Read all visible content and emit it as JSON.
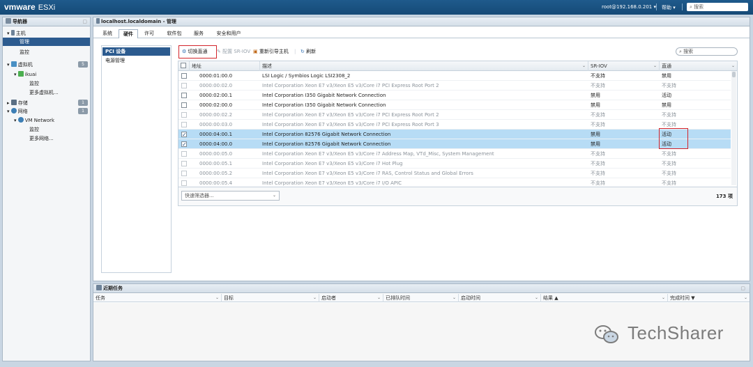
{
  "header": {
    "logo_brand": "vmware",
    "logo_product": "ESXi",
    "user": "root@192.168.0.201 ▾",
    "help": "帮助 ▾",
    "search_placeholder": "搜索"
  },
  "navigator": {
    "title": "导航器",
    "items": [
      {
        "label": "主机",
        "badge": ""
      },
      {
        "label": "管理",
        "badge": ""
      },
      {
        "label": "监控",
        "badge": ""
      },
      {
        "label": "虚拟机",
        "badge": "5"
      },
      {
        "label": "ikuai",
        "badge": ""
      },
      {
        "label": "监控",
        "badge": ""
      },
      {
        "label": "更多虚拟机...",
        "badge": ""
      },
      {
        "label": "存储",
        "badge": "1"
      },
      {
        "label": "网络",
        "badge": "1"
      },
      {
        "label": "VM Network",
        "badge": ""
      },
      {
        "label": "监控",
        "badge": ""
      },
      {
        "label": "更多网络...",
        "badge": ""
      }
    ]
  },
  "main": {
    "title": "localhost.localdomain - 管理",
    "tabs": [
      "系统",
      "硬件",
      "许可",
      "软件包",
      "服务",
      "安全和用户"
    ],
    "subnav": [
      "PCI 设备",
      "电源管理"
    ],
    "toolbar": {
      "toggle_passthrough": "切换直通",
      "configure_sriov": "配置 SR-IOV",
      "reboot_host": "重新引导主机",
      "refresh": "刷新",
      "search_placeholder": "搜索"
    },
    "columns": [
      "地址",
      "描述",
      "SR-IOV",
      "直通"
    ],
    "rows": [
      {
        "address": "0000:01:00.0",
        "desc": "LSI Logic / Symbios Logic LSI2308_2",
        "sriov": "不支持",
        "passthrough": "禁用"
      },
      {
        "address": "0000:00:02.0",
        "desc": "Intel Corporation Xeon E7 v3/Xeon E5 v3/Core i7 PCI Express Root Port 2",
        "sriov": "不支持",
        "passthrough": "不支持"
      },
      {
        "address": "0000:02:00.1",
        "desc": "Intel Corporation I350 Gigabit Network Connection",
        "sriov": "禁用",
        "passthrough": "活动"
      },
      {
        "address": "0000:02:00.0",
        "desc": "Intel Corporation I350 Gigabit Network Connection",
        "sriov": "禁用",
        "passthrough": "禁用"
      },
      {
        "address": "0000:00:02.2",
        "desc": "Intel Corporation Xeon E7 v3/Xeon E5 v3/Core i7 PCI Express Root Port 2",
        "sriov": "不支持",
        "passthrough": "不支持"
      },
      {
        "address": "0000:00:03.0",
        "desc": "Intel Corporation Xeon E7 v3/Xeon E5 v3/Core i7 PCI Express Root Port 3",
        "sriov": "不支持",
        "passthrough": "不支持"
      },
      {
        "address": "0000:04:00.1",
        "desc": "Intel Corporation 82576 Gigabit Network Connection",
        "sriov": "禁用",
        "passthrough": "活动"
      },
      {
        "address": "0000:04:00.0",
        "desc": "Intel Corporation 82576 Gigabit Network Connection",
        "sriov": "禁用",
        "passthrough": "活动"
      },
      {
        "address": "0000:00:05.0",
        "desc": "Intel Corporation Xeon E7 v3/Xeon E5 v3/Core i7 Address Map, VTd_Misc, System Management",
        "sriov": "不支持",
        "passthrough": "不支持"
      },
      {
        "address": "0000:00:05.1",
        "desc": "Intel Corporation Xeon E7 v3/Xeon E5 v3/Core i7 Hot Plug",
        "sriov": "不支持",
        "passthrough": "不支持"
      },
      {
        "address": "0000:00:05.2",
        "desc": "Intel Corporation Xeon E7 v3/Xeon E5 v3/Core i7 RAS, Control Status and Global Errors",
        "sriov": "不支持",
        "passthrough": "不支持"
      },
      {
        "address": "0000:00:05.4",
        "desc": "Intel Corporation Xeon E7 v3/Xeon E5 v3/Core i7 I/O APIC",
        "sriov": "不支持",
        "passthrough": "不支持"
      }
    ],
    "quick_filter": "快速筛选器...",
    "count": "173 项"
  },
  "tasks": {
    "title": "近期任务",
    "columns": [
      "任务",
      "目标",
      "启动者",
      "已排队时间",
      "启动时间",
      "结果 ▲",
      "完成时间 ▼"
    ]
  },
  "watermark": "TechSharer",
  "colors": {
    "header": "#1f5a8c",
    "selected": "#2c5b8f",
    "row_selected": "#b7dcf5",
    "highlight": "#d2232a"
  }
}
